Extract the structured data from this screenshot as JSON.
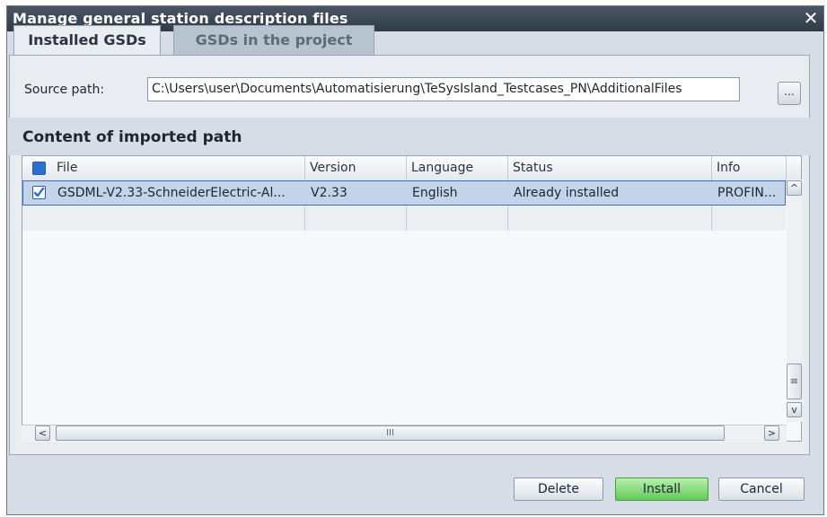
{
  "dialog": {
    "title": "Manage general station description files",
    "close_glyph": "✕"
  },
  "tabs": [
    {
      "label": "Installed GSDs",
      "active": true
    },
    {
      "label": "GSDs in the project",
      "active": false
    }
  ],
  "source": {
    "label": "Source path:",
    "value": "C:\\Users\\user\\Documents\\Automatisierung\\TeSysIsland_Testcases_PN\\AdditionalFiles",
    "browse_label": "..."
  },
  "content": {
    "title": "Content of imported path",
    "columns": [
      "File",
      "Version",
      "Language",
      "Status",
      "Info"
    ],
    "rows": [
      {
        "checked": true,
        "file": "GSDML-V2.33-SchneiderElectric-Al...",
        "version": "V2.33",
        "language": "English",
        "status": "Already installed",
        "info": "PROFIN..."
      }
    ]
  },
  "scrollbars": {
    "up": "^",
    "down": "v",
    "left": "<",
    "right": ">",
    "grip": "≡",
    "hgrip": "III"
  },
  "buttons": {
    "delete": "Delete",
    "install": "Install",
    "cancel": "Cancel"
  },
  "colors": {
    "title_bar": "#303b48",
    "selected_row": "#c2d3ea",
    "install_button": "#63c958",
    "checkbox": "#2d6fd1"
  }
}
